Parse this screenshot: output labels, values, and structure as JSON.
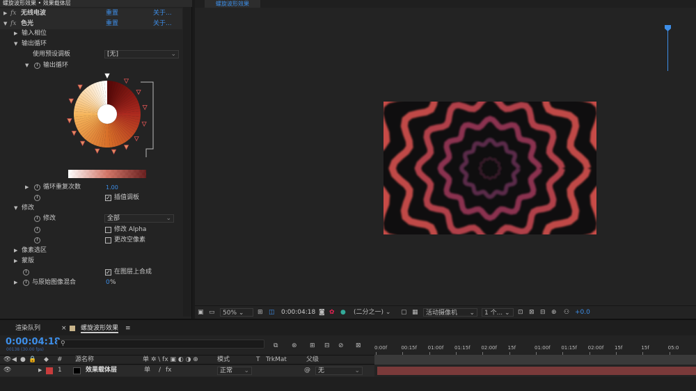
{
  "effects_panel": {
    "title": "螺旋波形效果 • 效果载体层",
    "effect1": {
      "fx": "fx",
      "name": "无线电波",
      "reset": "重置",
      "about": "关于..."
    },
    "effect2": {
      "fx": "fx",
      "name": "色光",
      "reset": "重置",
      "about": "关于..."
    },
    "input_phase": "输入相位",
    "output_cycle": "输出循环",
    "use_preset_palette": "使用预设调板",
    "preset_value": "[无]",
    "output_cycle_sub": "输出循环",
    "cycle_repeat": "循环重复次数",
    "cycle_repeat_value": "1.00",
    "interp_palette": "插值调板",
    "modify": "修改",
    "modify_sub": "修改",
    "modify_value": "全部",
    "modify_alpha": "修改 Alpha",
    "change_empty_pixels": "更改空像素",
    "pixel_selection": "像素选区",
    "mask": "蒙版",
    "composite_on_layer": "在图层上合成",
    "blend_with_original": "与原始图像混合",
    "blend_value": "0",
    "blend_unit": "%"
  },
  "viewer": {
    "tab": "螺旋波形效果",
    "zoom": "50%",
    "timecode": "0:00:04:18",
    "resolution": "(二分之一)",
    "camera": "活动摄像机",
    "views": "1 个...",
    "exposure": "+0.0"
  },
  "timeline": {
    "tab_render_queue": "渲染队列",
    "tab_comp": "螺旋波形效果",
    "timecode": "0:00:04:18",
    "fps": "00138 (30.00 fps)",
    "columns": {
      "hash": "#",
      "source_name": "源名称",
      "switches": "单 ✲ \\ fx ▣ ◐ ◑ ⊕",
      "mode": "模式",
      "t": "T",
      "trkmat": "TrkMat",
      "parent": "父级"
    },
    "layer": {
      "index": "1",
      "name": "效果载体层",
      "mode": "正常",
      "parent": "无"
    },
    "ruler_ticks": [
      "0:00f",
      "00:15f",
      "01:00f",
      "01:15f",
      "02:00f",
      "15f",
      "01:00f",
      "01:15f",
      "02:00f",
      "15f",
      "15f",
      "05:0"
    ]
  },
  "colors": {
    "accent": "#3d8ee8",
    "layer_label": "#c83c3c",
    "track": "#7a3a3a"
  }
}
